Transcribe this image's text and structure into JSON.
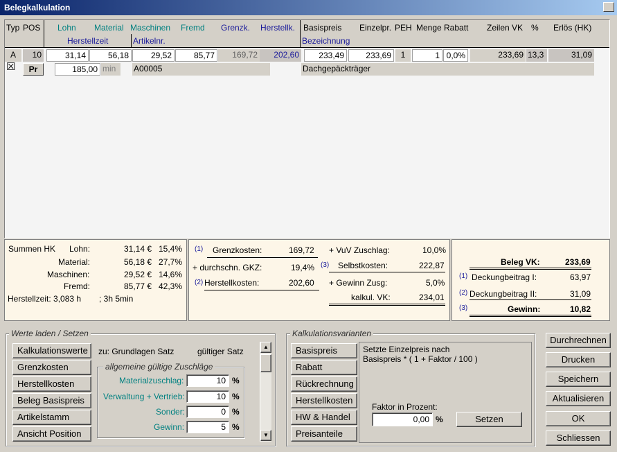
{
  "window": {
    "title": "Belegkalkulation"
  },
  "grid": {
    "headers_row1": {
      "typ": "Typ",
      "pos": "POS",
      "lohn": "Lohn",
      "material": "Material",
      "maschinen": "Maschinen",
      "fremd": "Fremd",
      "grenzk": "Grenzk.",
      "herstellk": "Herstellk.",
      "basispreis": "Basispreis",
      "einzelpr": "Einzelpr.",
      "peh": "PEH",
      "menge": "Menge",
      "rabatt": "Rabatt",
      "zeilen_vk": "Zeilen VK",
      "pct": "%",
      "erloes": "Erlös (HK)"
    },
    "headers_row2": {
      "herstellzeit": "Herstellzeit",
      "artikelnr": "Artikelnr.",
      "bezeichnung": "Bezeichnung"
    },
    "row": {
      "typ": "A",
      "pos": "10",
      "lohn": "31,14",
      "material": "56,18",
      "maschinen": "29,52",
      "fremd": "85,77",
      "grenzk": "169,72",
      "herstellk": "202,60",
      "basispreis": "233,49",
      "einzelpr": "233,69",
      "peh": "1",
      "menge": "1",
      "rabatt": "0,0%",
      "zeilen_vk": "233,69",
      "pct": "13,3",
      "erloes": "31,09",
      "checkbox": "☒",
      "pr": "Pr",
      "herstellzeit": "185,00",
      "unit": "min",
      "artikelnr": "A00005",
      "bezeichnung": "Dachgepäckträger"
    }
  },
  "summen": {
    "title": "Summen HK",
    "lohn_label": "Lohn:",
    "lohn_val": "31,14 €",
    "lohn_pct": "15,4%",
    "material_label": "Material:",
    "material_val": "56,18 €",
    "material_pct": "27,7%",
    "maschinen_label": "Maschinen:",
    "maschinen_val": "29,52 €",
    "maschinen_pct": "14,6%",
    "fremd_label": "Fremd:",
    "fremd_val": "85,77 €",
    "fremd_pct": "42,3%",
    "herstellzeit": "Herstellzeit: 3,083 h",
    "herstellzeit2": "; 3h 5min"
  },
  "kosten": {
    "m1": "(1)",
    "grenzkosten_label": "Grenzkosten:",
    "grenzkosten_val": "169,72",
    "gkz_label": "+ durchschn. GKZ:",
    "gkz_val": "19,4%",
    "m2": "(2)",
    "herstellkosten_label": "Herstellkosten:",
    "herstellkosten_val": "202,60",
    "vuv_label": "+ VuV Zuschlag:",
    "vuv_val": "10,0%",
    "m3": "(3)",
    "selbstkosten_label": "Selbstkosten:",
    "selbstkosten_val": "222,87",
    "gewinn_zusg_label": "+ Gewinn Zusg:",
    "gewinn_zusg_val": "5,0%",
    "kalkul_vk_label": "kalkul. VK:",
    "kalkul_vk_val": "234,01"
  },
  "beleg": {
    "vk_label": "Beleg VK:",
    "vk_val": "233,69",
    "m1": "(1)",
    "db1_label": "Deckungbeitrag I:",
    "db1_val": "63,97",
    "m2": "(2)",
    "db2_label": "Deckungbeitrag II:",
    "db2_val": "31,09",
    "m3": "(3)",
    "gewinn_label": "Gewinn:",
    "gewinn_val": "10,82"
  },
  "werte": {
    "group_label": "Werte laden / Setzen",
    "buttons": [
      "Kalkulationswerte",
      "Grenzkosten",
      "Herstellkosten",
      "Beleg Basispreis",
      "Artikelstamm",
      "Ansicht Position"
    ],
    "zu_text": "zu: Grundlagen Satz",
    "gueltig_text": "gültiger Satz",
    "sub_label": "allgemeine gültige Zuschläge",
    "fields": [
      {
        "label": "Materialzuschlag:",
        "value": "10",
        "unit": "%"
      },
      {
        "label": "Verwaltung + Vertrieb:",
        "value": "10",
        "unit": "%"
      },
      {
        "label": "Sonder:",
        "value": "0",
        "unit": "%"
      },
      {
        "label": "Gewinn:",
        "value": "5",
        "unit": "%"
      }
    ],
    "scroll_up": "▲",
    "scroll_down": "▼"
  },
  "varianten": {
    "group_label": "Kalkulationsvarianten",
    "buttons": [
      "Basispreis",
      "Rabatt",
      "Rückrechnung",
      "Herstellkosten",
      "HW & Handel",
      "Preisanteile"
    ],
    "desc_line1": "Setzte Einzelpreis nach",
    "desc_line2": "Basispreis * ( 1 + Faktor / 100 )",
    "faktor_label": "Faktor in Prozent:",
    "faktor_value": "0,00",
    "faktor_unit": "%",
    "setzen": "Setzen"
  },
  "actions": {
    "durchrechnen": "Durchrechnen",
    "drucken": "Drucken",
    "speichern": "Speichern",
    "aktualisieren": "Aktualisieren",
    "ok": "OK",
    "schliessen": "Schliessen"
  }
}
